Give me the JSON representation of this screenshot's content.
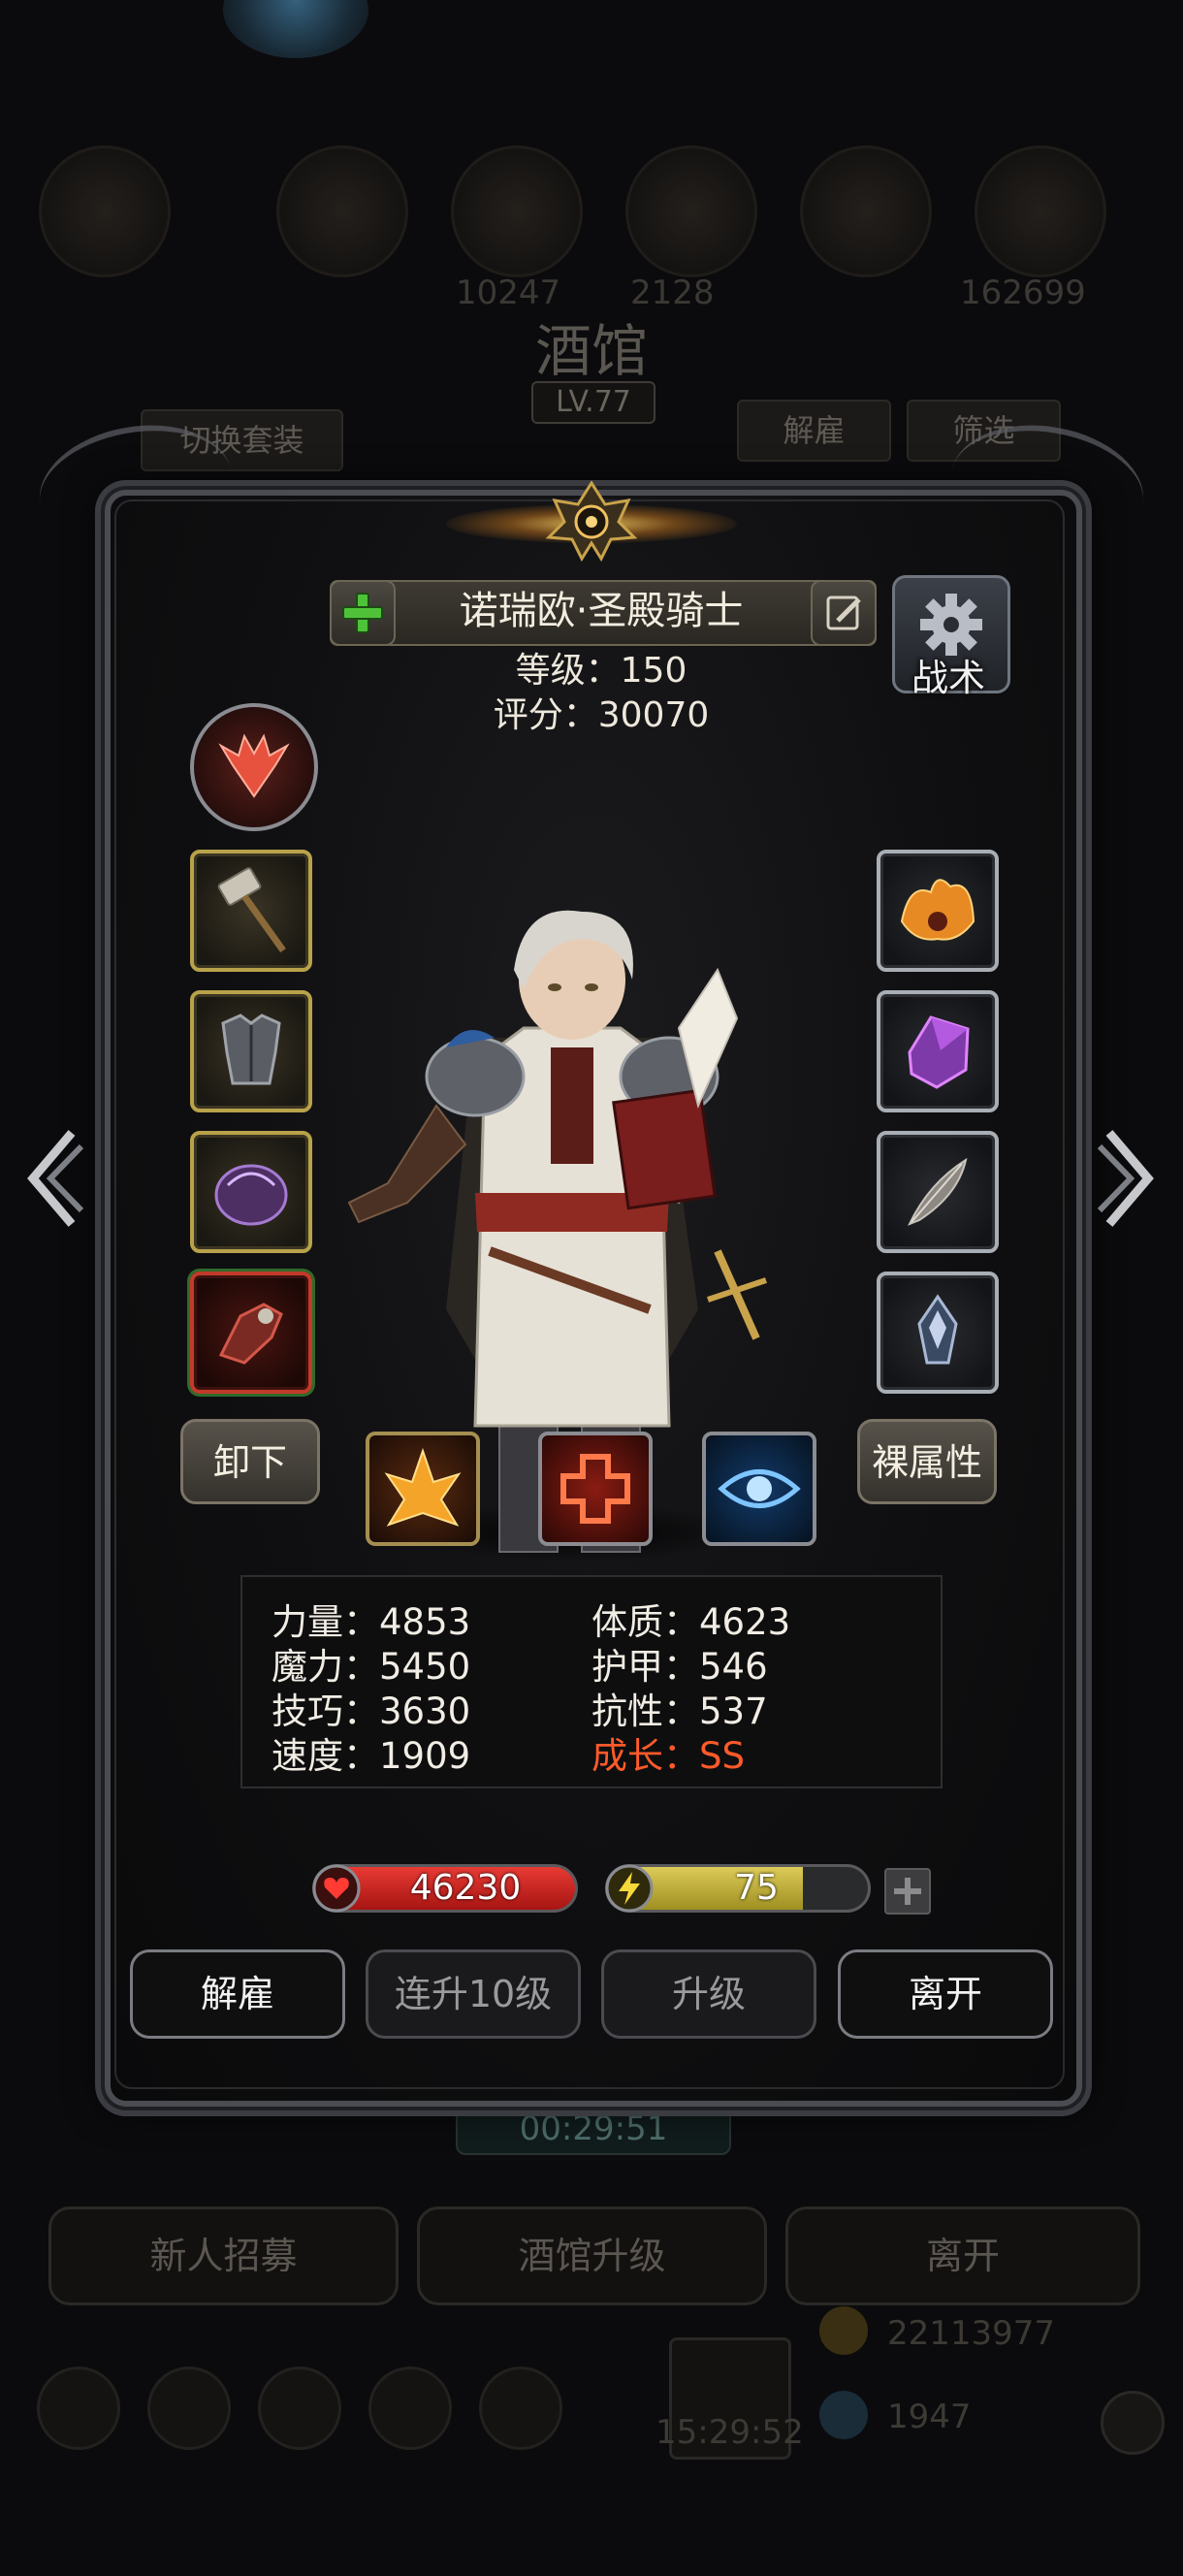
{
  "background": {
    "title": "酒馆",
    "level": "LV.77",
    "switch_outfit": "切换套装",
    "dismiss": "解雇",
    "filter": "筛选",
    "numbers": [
      "10247",
      "2128",
      "162699"
    ],
    "timer": "00:29:51",
    "bottom_buttons": [
      "新人招募",
      "酒馆升级",
      "离开"
    ],
    "gold": "22113977",
    "gems": "1947",
    "clock": "15:29:52"
  },
  "hero": {
    "name": "诺瑞欧·圣殿骑士",
    "level_label": "等级：150",
    "score_label": "评分：30070",
    "tactic_label": "战术",
    "unequip_label": "卸下",
    "base_attr_label": "裸属性"
  },
  "stats": {
    "left": [
      "力量：4853",
      "魔力：5450",
      "技巧：3630",
      "速度：1909"
    ],
    "right": [
      "体质：4623",
      "护甲：546",
      "抗性：537"
    ],
    "growth": "成长：SS"
  },
  "bars": {
    "hp": "46230",
    "energy": "75",
    "energy_fraction": 0.75
  },
  "actions": {
    "dismiss": "解雇",
    "level_up_10": "连升10级",
    "level_up": "升级",
    "leave": "离开"
  },
  "equipment_left": [
    "hammer-icon",
    "armor-icon",
    "helmet-icon",
    "gauntlet-icon"
  ],
  "equipment_right": [
    "fire-ring-icon",
    "crystal-icon",
    "feather-icon",
    "badge-icon"
  ],
  "skills": [
    "flame-burst-icon",
    "heal-cross-icon",
    "eye-icon"
  ],
  "colors": {
    "growth": "#ff5a2a",
    "hp": "#d8302b",
    "energy": "#c8b640",
    "slot_gold": "#b8a24a",
    "slot_silver": "#a9adb4"
  }
}
